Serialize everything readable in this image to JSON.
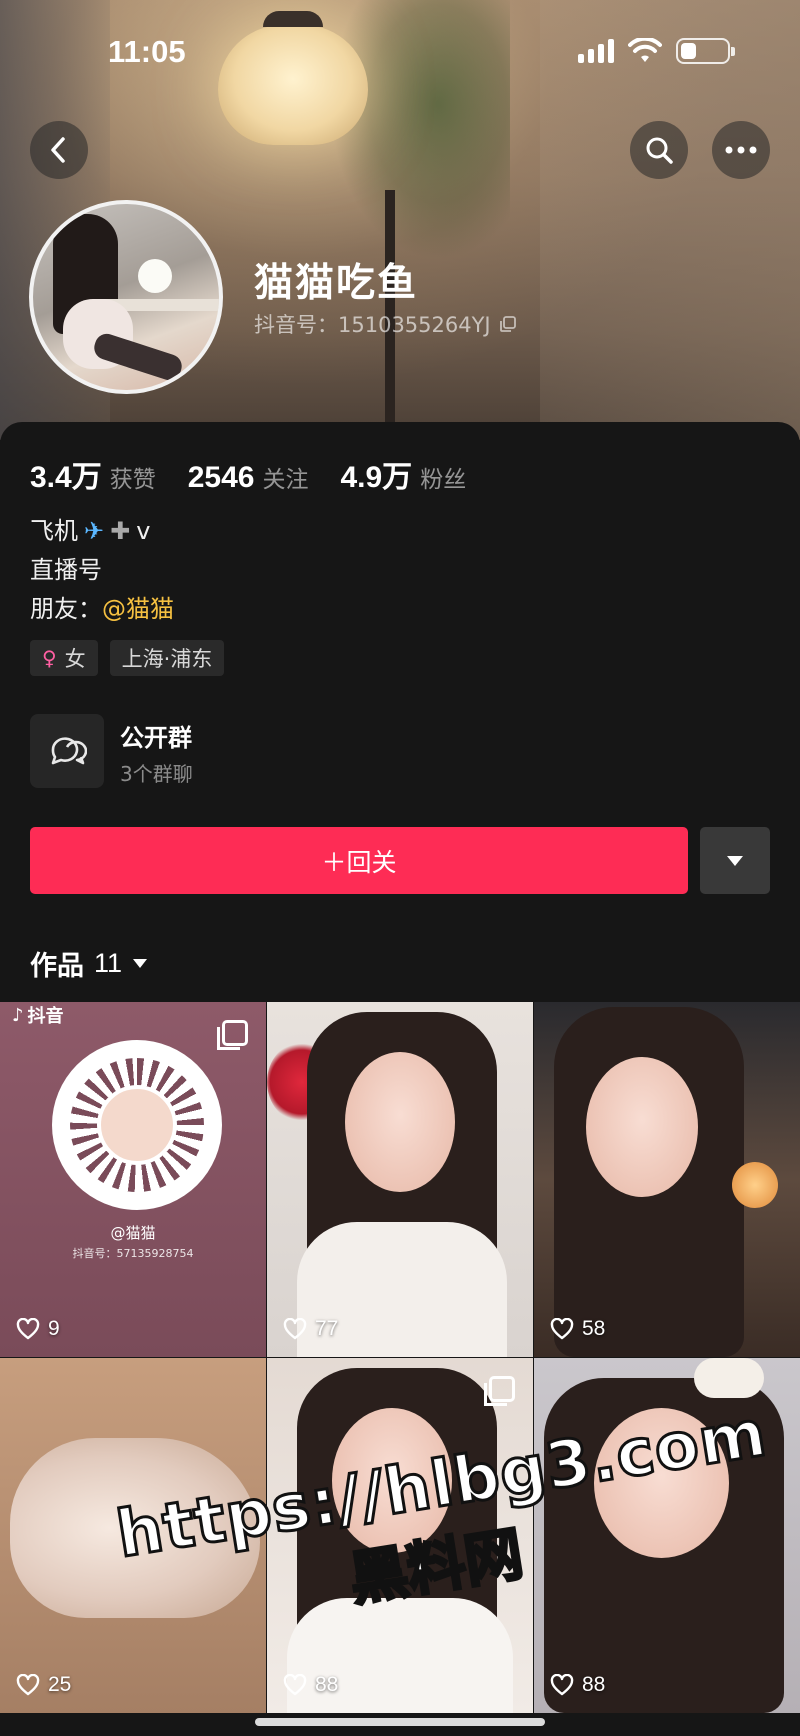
{
  "status_bar": {
    "time": "11:05",
    "battery_level": 0.35
  },
  "header": {
    "back_icon": "chevron-left-icon",
    "search_icon": "search-icon",
    "more_icon": "ellipsis-icon"
  },
  "profile": {
    "nickname": "猫猫吃鱼",
    "douyin_id": "抖音号：1510355264YJ",
    "copy_icon": "copy-icon"
  },
  "stats": [
    {
      "value": "3.4万",
      "label": "获赞"
    },
    {
      "value": "2546",
      "label": "关注"
    },
    {
      "value": "4.9万",
      "label": "粉丝"
    }
  ],
  "bio": {
    "line1_text": "飞机",
    "line1_tail": "v",
    "line2": "直播号",
    "line3_prefix": "朋友：",
    "line3_mention": "@猫猫"
  },
  "tags": [
    {
      "icon": "female-icon",
      "label": "女"
    },
    {
      "label": "上海·浦东"
    }
  ],
  "group": {
    "title": "公开群",
    "subtitle": "3个群聊",
    "icon": "chat-bubbles-icon"
  },
  "actions": {
    "follow_label": "＋回关",
    "dropdown_icon": "triangle-down-icon"
  },
  "works_tab": {
    "label": "作品",
    "count": "11"
  },
  "videos": [
    {
      "likes": "9",
      "qr_name": "@猫猫",
      "qr_id": "抖音号：57135928754",
      "brand": "抖音"
    },
    {
      "likes": "77"
    },
    {
      "likes": "58"
    },
    {
      "likes": "25"
    },
    {
      "likes": "88"
    },
    {
      "likes": "88"
    }
  ],
  "watermark": {
    "url": "https://hlbg3.com",
    "name": "黑料网"
  },
  "colors": {
    "accent": "#fe2c55",
    "mention": "#f5c041",
    "background": "#161616"
  }
}
